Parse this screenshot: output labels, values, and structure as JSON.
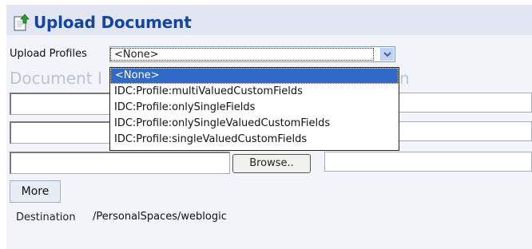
{
  "header": {
    "title": "Upload Document",
    "icon": "document-upload-icon"
  },
  "upload_profiles": {
    "label": "Upload Profiles",
    "selected": "<None>",
    "options": [
      "<None>",
      "IDC:Profile:multiValuedCustomFields",
      "IDC:Profile:onlySingleFields",
      "IDC:Profile:onlySingleValuedCustomFields",
      "IDC:Profile:singleValuedCustomFields"
    ]
  },
  "section": {
    "heading_visible": "Document I",
    "heading_tail": "n"
  },
  "buttons": {
    "browse": "Browse..",
    "more": "More"
  },
  "destination": {
    "label": "Destination",
    "value": "/PersonalSpaces/weblogic"
  },
  "colors": {
    "title": "#17459c",
    "selected_option": "#3169c6",
    "header_band": "#e1e6f2"
  }
}
